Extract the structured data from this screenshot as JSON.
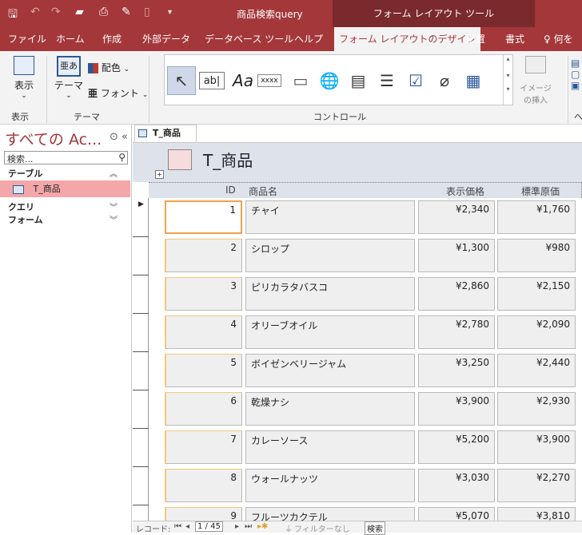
{
  "titlebar": {
    "doc_title": "商品検索query",
    "context_tab": "フォーム レイアウト ツール"
  },
  "tabs": {
    "file": "ファイル",
    "home": "ホーム",
    "create": "作成",
    "external": "外部データ",
    "dbtools": "データベース ツール",
    "help": "ヘルプ",
    "form_layout_design": "フォーム レイアウトのデザイン",
    "arrange": "配置",
    "format": "書式",
    "tellme": "何を"
  },
  "ribbon": {
    "view_label": "表示",
    "theme_label": "テーマ",
    "color_label": "配色",
    "font_label": "フォント",
    "textbox_glyph": "ab|",
    "label_glyph": "Aa",
    "button_glyph": "xxxx",
    "image_insert_label": "イメージ",
    "image_insert_label2": "の挿入",
    "groups": {
      "view": "表示",
      "theme": "テーマ",
      "controls": "コントロール",
      "header": "ヘ"
    }
  },
  "nav": {
    "title": "すべての Ac...",
    "search_placeholder": "検索...",
    "groups": {
      "tables": "テーブル",
      "queries": "クエリ",
      "forms": "フォーム"
    },
    "table_item": "T_商品"
  },
  "document": {
    "tab_label": "T_商品",
    "form_title": "T_商品"
  },
  "columns": {
    "id": "ID",
    "name": "商品名",
    "price": "表示価格",
    "cost": "標準原価"
  },
  "rows": [
    {
      "id": "1",
      "name": "チャイ",
      "price": "¥2,340",
      "cost": "¥1,760"
    },
    {
      "id": "2",
      "name": "シロップ",
      "price": "¥1,300",
      "cost": "¥980"
    },
    {
      "id": "3",
      "name": "ピリカラタバスコ",
      "price": "¥2,860",
      "cost": "¥2,150"
    },
    {
      "id": "4",
      "name": "オリーブオイル",
      "price": "¥2,780",
      "cost": "¥2,090"
    },
    {
      "id": "5",
      "name": "ボイゼンベリージャム",
      "price": "¥3,250",
      "cost": "¥2,440"
    },
    {
      "id": "6",
      "name": "乾燥ナシ",
      "price": "¥3,900",
      "cost": "¥2,930"
    },
    {
      "id": "7",
      "name": "カレーソース",
      "price": "¥5,200",
      "cost": "¥3,900"
    },
    {
      "id": "8",
      "name": "ウォールナッツ",
      "price": "¥3,030",
      "cost": "¥2,270"
    },
    {
      "id": "9",
      "name": "フルーツカクテル",
      "price": "¥5,070",
      "cost": "¥3,810"
    }
  ],
  "record_nav": {
    "label": "レコード:",
    "position": "1 / 45",
    "filter": "フィルターなし",
    "search": "検索"
  }
}
